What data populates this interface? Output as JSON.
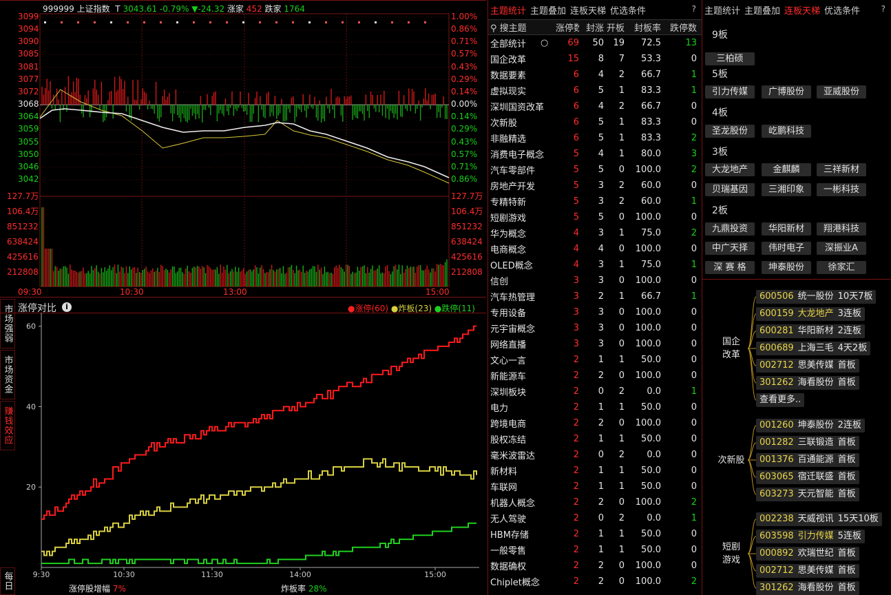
{
  "index_header": {
    "code": "999999",
    "name": "上证指数",
    "t_label": "T",
    "price": "3043.61",
    "pct": "-0.79%",
    "change": "▼-24.32",
    "up_label": "涨家",
    "up_count": "452",
    "down_label": "跌家",
    "down_count": "1764"
  },
  "price_axis_left": [
    "3099",
    "3094",
    "3090",
    "3085",
    "3081",
    "3077",
    "3072",
    "3068",
    "3064",
    "3059",
    "3055",
    "3050",
    "3046",
    "3042"
  ],
  "price_axis_right": [
    "1.00%",
    "0.86%",
    "0.71%",
    "0.57%",
    "0.43%",
    "0.29%",
    "0.14%",
    "0.00%",
    "0.14%",
    "0.29%",
    "0.43%",
    "0.57%",
    "0.71%",
    "0.86%"
  ],
  "volume_axis": [
    "127.7万",
    "106.4万",
    "851232",
    "638424",
    "425616",
    "212808"
  ],
  "time_axis_top": [
    "09:30",
    "10:30",
    "13:00",
    "15:00"
  ],
  "compare_panel": {
    "title": "涨停对比",
    "info_icon": "info-circle-icon",
    "legend": [
      {
        "label": "涨停(60)",
        "color": "#ff2020"
      },
      {
        "label": "炸板(23)",
        "color": "#d8d040"
      },
      {
        "label": "跌停(11)",
        "color": "#20d020"
      }
    ],
    "y_ticks": [
      "60",
      "40",
      "20"
    ],
    "x_ticks": [
      "9:30",
      "10:30",
      "11:30",
      "14:00",
      "15:00"
    ],
    "footer_left_label": "涨停股增幅",
    "footer_left_value": "7%",
    "footer_right_label": "炸板率",
    "footer_right_value": "28%"
  },
  "side_tabs": [
    "市场强弱",
    "市场资金",
    "赚钱效应",
    "每日"
  ],
  "chart_data": {
    "type": "line",
    "x": [
      "9:30",
      "10:30",
      "11:30",
      "14:00",
      "15:00"
    ],
    "ylim": [
      0,
      62
    ],
    "series": [
      {
        "name": "涨停(60)",
        "values": [
          12,
          30,
          37,
          47,
          60
        ]
      },
      {
        "name": "炸板(23)",
        "values": [
          3,
          14,
          20,
          26,
          23
        ]
      },
      {
        "name": "跌停(11)",
        "values": [
          1,
          2,
          1,
          5,
          11
        ]
      }
    ]
  },
  "theme_table": {
    "tabs": [
      "主题统计",
      "主题叠加",
      "连板天梯",
      "优选条件"
    ],
    "help": "?",
    "headers": [
      "搜主题",
      "涨停数↓",
      "封涨",
      "开板",
      "封板率",
      "跌停数"
    ],
    "rows": [
      [
        "全部统计",
        "69",
        "50",
        "19",
        "72.5",
        "13"
      ],
      [
        "国企改革",
        "15",
        "8",
        "7",
        "53.3",
        "0"
      ],
      [
        "数据要素",
        "6",
        "4",
        "2",
        "66.7",
        "1"
      ],
      [
        "虚拟现实",
        "6",
        "5",
        "1",
        "83.3",
        "1"
      ],
      [
        "深圳国资改革",
        "6",
        "4",
        "2",
        "66.7",
        "0"
      ],
      [
        "次新股",
        "6",
        "5",
        "1",
        "83.3",
        "0"
      ],
      [
        "非融精选",
        "6",
        "5",
        "1",
        "83.3",
        "2"
      ],
      [
        "消费电子概念",
        "5",
        "4",
        "1",
        "80.0",
        "3"
      ],
      [
        "汽车零部件",
        "5",
        "5",
        "0",
        "100.0",
        "2"
      ],
      [
        "房地产开发",
        "5",
        "3",
        "2",
        "60.0",
        "0"
      ],
      [
        "专精特新",
        "5",
        "3",
        "2",
        "60.0",
        "1"
      ],
      [
        "短剧游戏",
        "5",
        "5",
        "0",
        "100.0",
        "0"
      ],
      [
        "华为概念",
        "4",
        "3",
        "1",
        "75.0",
        "2"
      ],
      [
        "电商概念",
        "4",
        "4",
        "0",
        "100.0",
        "0"
      ],
      [
        "OLED概念",
        "4",
        "3",
        "1",
        "75.0",
        "1"
      ],
      [
        "信创",
        "3",
        "3",
        "0",
        "100.0",
        "0"
      ],
      [
        "汽车热管理",
        "3",
        "2",
        "1",
        "66.7",
        "1"
      ],
      [
        "专用设备",
        "3",
        "3",
        "0",
        "100.0",
        "0"
      ],
      [
        "元宇宙概念",
        "3",
        "3",
        "0",
        "100.0",
        "0"
      ],
      [
        "网络直播",
        "3",
        "3",
        "0",
        "100.0",
        "0"
      ],
      [
        "文心一言",
        "2",
        "1",
        "1",
        "50.0",
        "0"
      ],
      [
        "新能源车",
        "2",
        "2",
        "0",
        "100.0",
        "0"
      ],
      [
        "深圳板块",
        "2",
        "0",
        "2",
        "0.0",
        "1"
      ],
      [
        "电力",
        "2",
        "1",
        "1",
        "50.0",
        "0"
      ],
      [
        "跨境电商",
        "2",
        "2",
        "0",
        "100.0",
        "0"
      ],
      [
        "股权冻结",
        "2",
        "1",
        "1",
        "50.0",
        "0"
      ],
      [
        "毫米波雷达",
        "2",
        "0",
        "2",
        "0.0",
        "0"
      ],
      [
        "新材料",
        "2",
        "1",
        "1",
        "50.0",
        "0"
      ],
      [
        "车联网",
        "2",
        "1",
        "1",
        "50.0",
        "0"
      ],
      [
        "机器人概念",
        "2",
        "2",
        "0",
        "100.0",
        "2"
      ],
      [
        "无人驾驶",
        "2",
        "0",
        "2",
        "0.0",
        "1"
      ],
      [
        "HBM存储",
        "2",
        "1",
        "1",
        "50.0",
        "0"
      ],
      [
        "一般零售",
        "2",
        "1",
        "1",
        "50.0",
        "0"
      ],
      [
        "数据确权",
        "2",
        "2",
        "0",
        "100.0",
        "0"
      ],
      [
        "Chiplet概念",
        "2",
        "2",
        "0",
        "100.0",
        "2"
      ]
    ]
  },
  "limit_panel": {
    "tabs": [
      "主题统计",
      "主题叠加",
      "连板天梯",
      "优选条件"
    ],
    "help": "?",
    "levels": [
      {
        "title": "9板",
        "stocks": [
          "三柏硕"
        ]
      },
      {
        "title": "5板",
        "stocks": [
          "引力传媒",
          "广博股份",
          "亚威股份"
        ]
      },
      {
        "title": "4板",
        "stocks": [
          "圣龙股份",
          "屹鹏科技"
        ]
      },
      {
        "title": "3板",
        "stocks": [
          "大龙地产",
          "金麒麟",
          "三祥新材",
          "贝瑞基因",
          "三湘印象",
          "一彬科技"
        ]
      },
      {
        "title": "2板",
        "stocks": [
          "九鼎投资",
          "华阳新材",
          "翔港科技",
          "中广天择",
          "伟时电子",
          "深振业A",
          "深 赛 格",
          "坤泰股份",
          "徐家汇"
        ]
      }
    ],
    "groups": [
      {
        "label": "国企\n改革",
        "items": [
          {
            "code": "600506",
            "name": "统一股份",
            "tag": "10天7板"
          },
          {
            "code": "600159",
            "name": "大龙地产",
            "tag": "3连板"
          },
          {
            "code": "600281",
            "name": "华阳新材",
            "tag": "2连板"
          },
          {
            "code": "600689",
            "name": "上海三毛",
            "tag": "4天2板"
          },
          {
            "code": "002712",
            "name": "思美传媒",
            "tag": "首板"
          },
          {
            "code": "301262",
            "name": "海看股份",
            "tag": "首板"
          },
          {
            "code": "",
            "name": "查看更多..",
            "tag": ""
          }
        ]
      },
      {
        "label": "次新股",
        "items": [
          {
            "code": "001260",
            "name": "坤泰股份",
            "tag": "2连板"
          },
          {
            "code": "001282",
            "name": "三联锻造",
            "tag": "首板"
          },
          {
            "code": "001376",
            "name": "百通能源",
            "tag": "首板"
          },
          {
            "code": "603065",
            "name": "宿迁联盛",
            "tag": "首板"
          },
          {
            "code": "603273",
            "name": "天元智能",
            "tag": "首板"
          }
        ]
      },
      {
        "label": "短剧\n游戏",
        "items": [
          {
            "code": "002238",
            "name": "天威视讯",
            "tag": "15天10板"
          },
          {
            "code": "603598",
            "name": "引力传媒",
            "tag": "5连板"
          },
          {
            "code": "000892",
            "name": "欢瑞世纪",
            "tag": "首板"
          },
          {
            "code": "002712",
            "name": "思美传媒",
            "tag": "首板"
          },
          {
            "code": "301262",
            "name": "海看股份",
            "tag": "首板"
          }
        ]
      }
    ]
  }
}
